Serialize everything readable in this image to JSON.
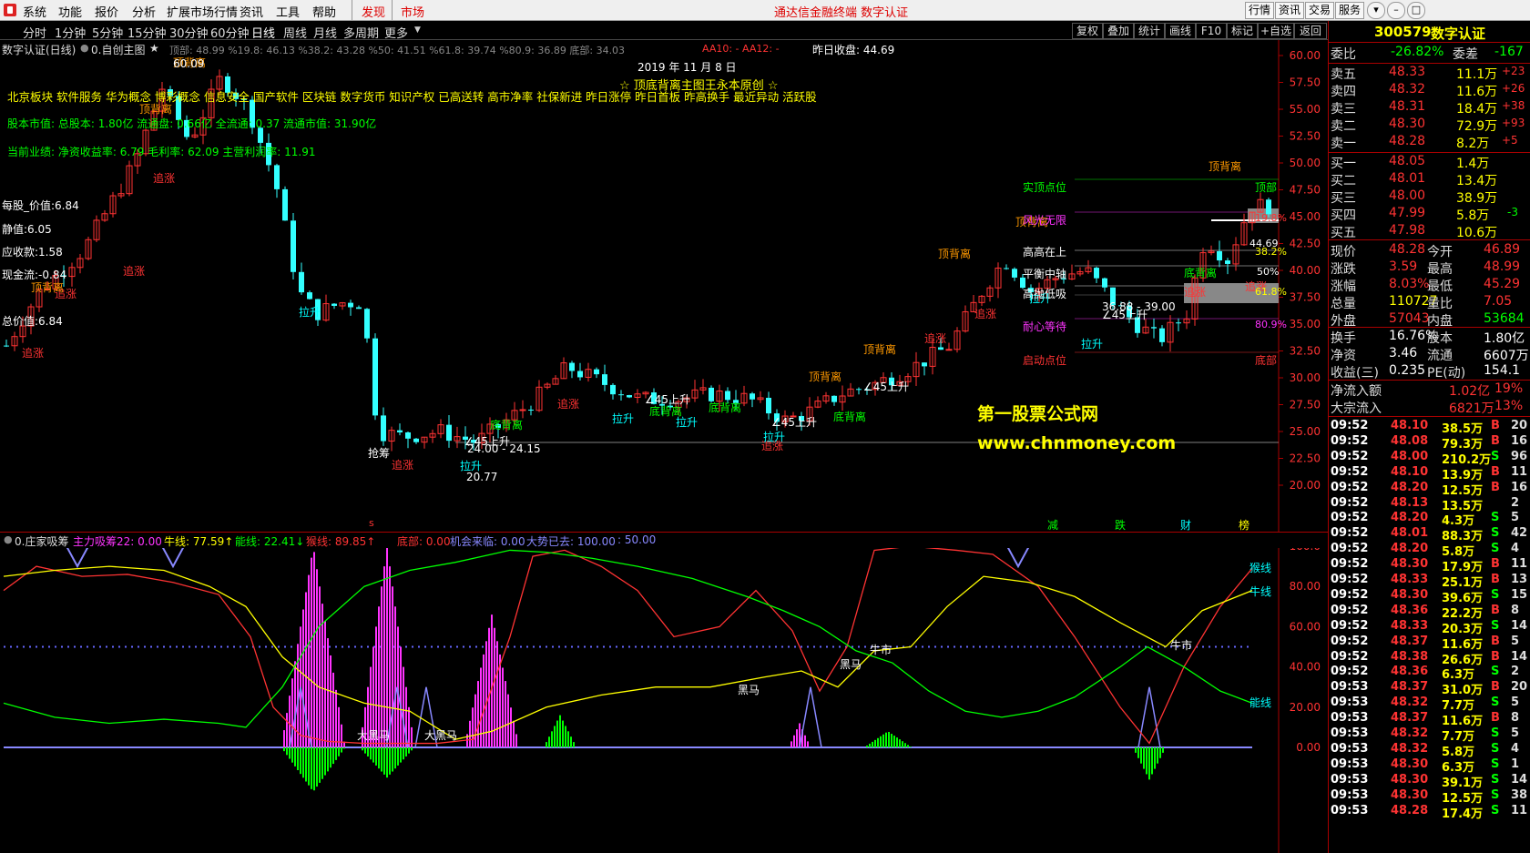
{
  "menu": {
    "items": [
      "系统",
      "功能",
      "报价",
      "分析",
      "扩展市场行情",
      "资讯",
      "工具",
      "帮助"
    ],
    "discover": "发现",
    "market": "市场",
    "center_notice": "通达信金融终端  数字认证",
    "right_buttons": [
      "行情",
      "资讯",
      "交易",
      "服务"
    ]
  },
  "periods": [
    "分时",
    "1分钟",
    "5分钟",
    "15分钟",
    "30分钟",
    "60分钟",
    "日线",
    "周线",
    "月线",
    "多周期",
    "更多"
  ],
  "active_period": "日线",
  "chart_buttons": [
    "复权",
    "叠加",
    "统计",
    "画线",
    "F10",
    "标记",
    "+自选",
    "返回"
  ],
  "main_chart": {
    "header_title": "数字认证(日线)",
    "formula": "0.自创主图",
    "params": "顶部: 48.99 %19.8: 46.13 %38.2: 43.28 %50: 41.51 %61.8: 39.74 %80.9: 36.89 底部: 34.03",
    "aa": "AA10: -  AA12: -",
    "prev_close": "昨日收盘: 44.69",
    "date": "2019 年 11 月 8 日",
    "banner": "☆ 顶底背离主图王永本原创 ☆",
    "concepts": "北京板块 软件服务 华为概念 博彩概念 信息安全 国产软件 区块链 数字货币 知识产权 已高送转 高市净率 社保新进 昨日涨停 昨日首板 昨高换手 最近异动 活跃股",
    "equity": "股本市值: 总股本: 1.80亿 流通盘: 0.66亿 全流通: 0.37 流通市值: 31.90亿",
    "performance": "当前业绩: 净资收益率: 6.79 毛利率: 62.09 主营利润率: 11.91",
    "left_values": [
      "每股_价值:6.84",
      "静值:6.05",
      "应收款:1.58",
      "现金流:-0.84",
      "总价值:6.84"
    ],
    "right_levels": [
      "实顶点位",
      "风光无限",
      "高高在上",
      "平衡中轴",
      "高抛低吸",
      "耐心等待",
      "启动点位"
    ],
    "right_small_values": [
      "19.8%",
      "44.69",
      "38.2%",
      "50%",
      "61.8%",
      "80.9%",
      "底部",
      "顶部"
    ],
    "annotations": {
      "zhuizhang": "追涨",
      "dibeili": "底背离",
      "dingbeili": "顶背离",
      "lasheng": "拉升",
      "up45": "∠45上升",
      "high_mark": "60.09",
      "low_mark": "20.77",
      "mid_mark": "24.00 - 24.15",
      "right_mark": "36.88 - 39.00",
      "zhangfen": "抢筹",
      "bottom_tags": [
        "减",
        "跌",
        "财",
        "榜"
      ],
      "s_tag": "s"
    },
    "watermark1": "第一股票公式网",
    "watermark2": "www.chnmoney.com",
    "y_ticks": [
      "60.00",
      "57.50",
      "55.00",
      "52.50",
      "50.00",
      "47.50",
      "45.00",
      "42.50",
      "40.00",
      "37.50",
      "35.00",
      "32.50",
      "30.00",
      "27.50",
      "25.00",
      "22.50",
      "20.00"
    ]
  },
  "indicator": {
    "name": "0.庄家吸筹",
    "main_force": "主力吸筹22: 0.00",
    "bull": "牛线: 77.59↑",
    "energy": "能线: 22.41↓",
    "monkey": "猴线: 89.85↑",
    "bottom": "底部: 0.00",
    "chance": "机会来临: 0.00",
    "trend_gone": "大势已去: 100.00",
    "fifty": ": 50.00",
    "y_ticks": [
      "100.0",
      "80.00",
      "60.00",
      "40.00",
      "20.00",
      "0.00"
    ],
    "labels": {
      "monkey": "猴线",
      "bull": "牛线",
      "energy": "能线",
      "bull_market": "牛市",
      "dark_horse": "黑马",
      "big_dark_horse": "大黑马"
    }
  },
  "quote": {
    "code": "300579",
    "name": "数字认证",
    "weibi_label": "委比",
    "weibi": "-26.82%",
    "weicha_label": "委差",
    "weicha": "-167",
    "sell": [
      {
        "label": "卖五",
        "price": "48.33",
        "vol": "11.1万",
        "chg": "+23"
      },
      {
        "label": "卖四",
        "price": "48.32",
        "vol": "11.6万",
        "chg": "+26"
      },
      {
        "label": "卖三",
        "price": "48.31",
        "vol": "18.4万",
        "chg": "+38"
      },
      {
        "label": "卖二",
        "price": "48.30",
        "vol": "72.9万",
        "chg": "+93"
      },
      {
        "label": "卖一",
        "price": "48.28",
        "vol": "8.2万",
        "chg": "+5"
      }
    ],
    "buy": [
      {
        "label": "买一",
        "price": "48.05",
        "vol": "1.4万",
        "chg": ""
      },
      {
        "label": "买二",
        "price": "48.01",
        "vol": "13.4万",
        "chg": ""
      },
      {
        "label": "买三",
        "price": "48.00",
        "vol": "38.9万",
        "chg": ""
      },
      {
        "label": "买四",
        "price": "47.99",
        "vol": "5.8万",
        "chg": "-3"
      },
      {
        "label": "买五",
        "price": "47.98",
        "vol": "10.6万",
        "chg": ""
      }
    ],
    "stats": [
      {
        "l1": "现价",
        "v1": "48.28",
        "l2": "今开",
        "v2": "46.89"
      },
      {
        "l1": "涨跌",
        "v1": "3.59",
        "l2": "最高",
        "v2": "48.99"
      },
      {
        "l1": "涨幅",
        "v1": "8.03%",
        "l2": "最低",
        "v2": "45.29"
      },
      {
        "l1": "总量",
        "v1": "110727",
        "l2": "量比",
        "v2": "7.05"
      },
      {
        "l1": "外盘",
        "v1": "57043",
        "l2": "内盘",
        "v2": "53684"
      }
    ],
    "stats2": [
      {
        "l1": "换手",
        "v1": "16.76%",
        "l2": "股本",
        "v2": "1.80亿"
      },
      {
        "l1": "净资",
        "v1": "3.46",
        "l2": "流通",
        "v2": "6607万"
      },
      {
        "l1": "收益(三)",
        "v1": "0.235",
        "l2": "PE(动)",
        "v2": "154.1"
      }
    ],
    "flow": [
      {
        "label": "净流入额",
        "v": "1.02亿",
        "p": "19%"
      },
      {
        "label": "大宗流入",
        "v": "6821万",
        "p": "13%"
      }
    ],
    "ticks": [
      {
        "t": "09:52",
        "p": "48.10",
        "v": "38.5万",
        "bs": "B",
        "n": "20"
      },
      {
        "t": "09:52",
        "p": "48.08",
        "v": "79.3万",
        "bs": "B",
        "n": "16"
      },
      {
        "t": "09:52",
        "p": "48.00",
        "v": "210.2万",
        "bs": "S",
        "n": "96"
      },
      {
        "t": "09:52",
        "p": "48.10",
        "v": "13.9万",
        "bs": "B",
        "n": "11"
      },
      {
        "t": "09:52",
        "p": "48.20",
        "v": "12.5万",
        "bs": "B",
        "n": "16"
      },
      {
        "t": "09:52",
        "p": "48.13",
        "v": "13.5万",
        "bs": "",
        "n": "2"
      },
      {
        "t": "09:52",
        "p": "48.20",
        "v": "4.3万",
        "bs": "S",
        "n": "5"
      },
      {
        "t": "09:52",
        "p": "48.01",
        "v": "88.3万",
        "bs": "S",
        "n": "42"
      },
      {
        "t": "09:52",
        "p": "48.20",
        "v": "5.8万",
        "bs": "S",
        "n": "4"
      },
      {
        "t": "09:52",
        "p": "48.30",
        "v": "17.9万",
        "bs": "B",
        "n": "11"
      },
      {
        "t": "09:52",
        "p": "48.33",
        "v": "25.1万",
        "bs": "B",
        "n": "13"
      },
      {
        "t": "09:52",
        "p": "48.30",
        "v": "39.6万",
        "bs": "S",
        "n": "15"
      },
      {
        "t": "09:52",
        "p": "48.36",
        "v": "22.2万",
        "bs": "B",
        "n": "8"
      },
      {
        "t": "09:52",
        "p": "48.33",
        "v": "20.3万",
        "bs": "S",
        "n": "14"
      },
      {
        "t": "09:52",
        "p": "48.37",
        "v": "11.6万",
        "bs": "B",
        "n": "5"
      },
      {
        "t": "09:52",
        "p": "48.38",
        "v": "26.6万",
        "bs": "B",
        "n": "14"
      },
      {
        "t": "09:52",
        "p": "48.36",
        "v": "6.3万",
        "bs": "S",
        "n": "2"
      },
      {
        "t": "09:53",
        "p": "48.37",
        "v": "31.0万",
        "bs": "B",
        "n": "20"
      },
      {
        "t": "09:53",
        "p": "48.32",
        "v": "7.7万",
        "bs": "S",
        "n": "5"
      },
      {
        "t": "09:53",
        "p": "48.37",
        "v": "11.6万",
        "bs": "B",
        "n": "8"
      },
      {
        "t": "09:53",
        "p": "48.32",
        "v": "7.7万",
        "bs": "S",
        "n": "5"
      },
      {
        "t": "09:53",
        "p": "48.32",
        "v": "5.8万",
        "bs": "S",
        "n": "4"
      },
      {
        "t": "09:53",
        "p": "48.30",
        "v": "6.3万",
        "bs": "S",
        "n": "1"
      },
      {
        "t": "09:53",
        "p": "48.30",
        "v": "39.1万",
        "bs": "S",
        "n": "14"
      },
      {
        "t": "09:53",
        "p": "48.30",
        "v": "12.5万",
        "bs": "S",
        "n": "38"
      },
      {
        "t": "09:53",
        "p": "48.28",
        "v": "17.4万",
        "bs": "S",
        "n": "11"
      }
    ]
  },
  "colors": {
    "up": "#ff3333",
    "down": "#33ffff",
    "yellow": "#ffff00",
    "green": "#00ff00",
    "magenta": "#ff33ff",
    "purple": "#8888ff"
  }
}
